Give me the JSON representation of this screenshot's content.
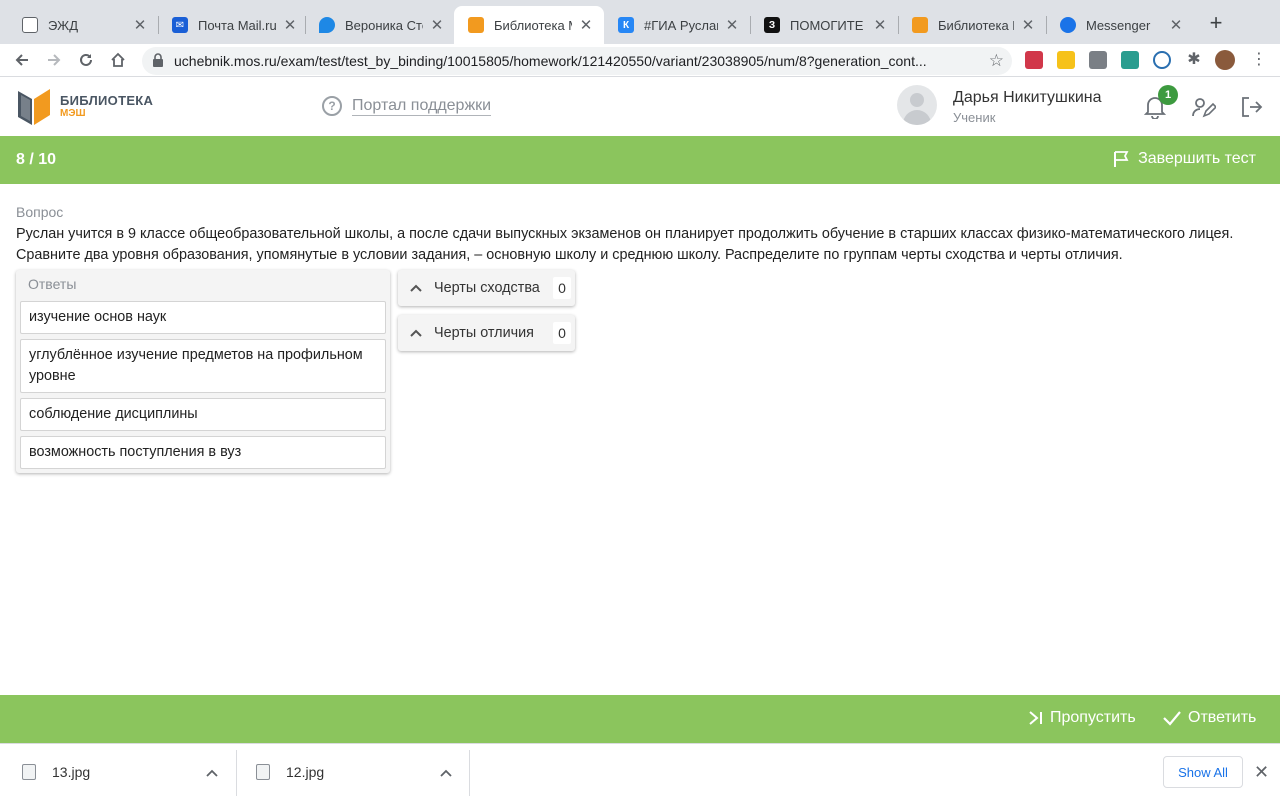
{
  "browser": {
    "tabs": [
      {
        "title": "ЭЖД",
        "icon": "document-icon",
        "color": "#5f6368"
      },
      {
        "title": "Почта Mail.ru",
        "icon": "mail-icon",
        "color": "#1a5fd6"
      },
      {
        "title": "Вероника Сте",
        "icon": "swirl-icon",
        "color": "#1e88e5"
      },
      {
        "title": "Библиотека М",
        "icon": "book-icon",
        "color": "#f29a1f"
      },
      {
        "title": "#ГИА Руслан у",
        "icon": "vk-icon",
        "color": "#2787f5"
      },
      {
        "title": "ПОМОГИТЕ , I",
        "icon": "znanija-icon",
        "color": "#111111"
      },
      {
        "title": "Библиотека М",
        "icon": "book-icon",
        "color": "#f29a1f"
      },
      {
        "title": "Messenger",
        "icon": "messenger-icon",
        "color": "#1a73e8"
      }
    ],
    "url": "uchebnik.mos.ru/exam/test/test_by_binding/10015805/homework/121420550/variant/23038905/num/8?generation_cont..."
  },
  "header": {
    "logo_line1": "БИБЛИОТЕКА",
    "logo_line2": "МЭШ",
    "support_link": "Портал поддержки",
    "user_name": "Дарья Никитушкина",
    "user_role": "Ученик",
    "notifications_count": "1"
  },
  "test": {
    "counter": "8 / 10",
    "finish_label": "Завершить тест",
    "question_label": "Вопрос",
    "question_text": "Руслан учится в 9 классе общеобразовательной школы, а после сдачи выпускных экзаменов он планирует продолжить обучение в старших классах физико-математического лицея. Сравните два уровня образования, упомянутые в условии задания, – основную школу и среднюю школу. Распределите по группам черты сходства и черты отличия.",
    "answers_header": "Ответы",
    "answers": [
      "изучение основ наук",
      "углублённое изучение предметов на профильном уровне",
      "соблюдение дисциплины",
      "возможность поступления в вуз"
    ],
    "groups": [
      {
        "label": "Черты сходства",
        "count": "0"
      },
      {
        "label": "Черты отличия",
        "count": "0"
      }
    ],
    "skip_label": "Пропустить",
    "answer_label": "Ответить"
  },
  "downloads": {
    "files": [
      "13.jpg",
      "12.jpg"
    ],
    "show_all": "Show All"
  },
  "colors": {
    "accent_green": "#8bc55d",
    "badge_green": "#3d9a3f",
    "logo_orange": "#f29a1f"
  }
}
